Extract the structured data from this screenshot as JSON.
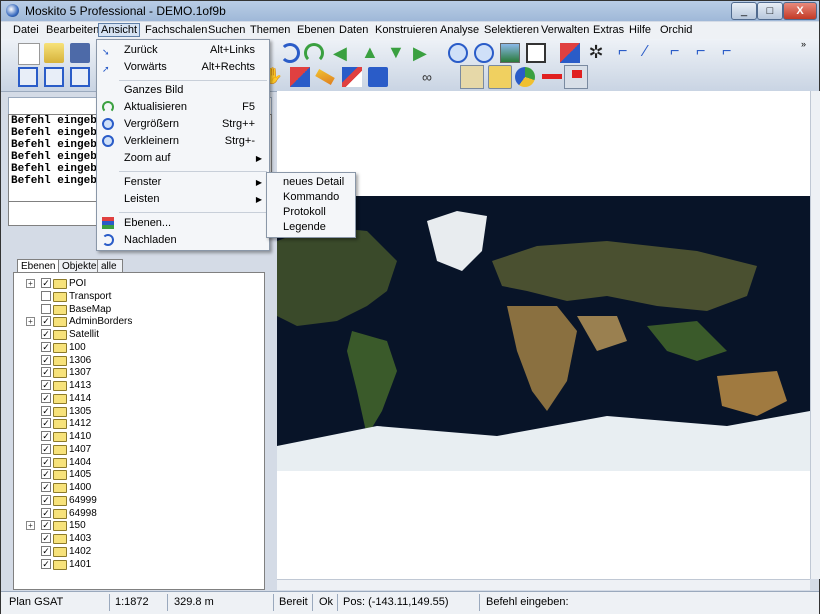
{
  "window": {
    "title": "Moskito 5 Professional - DEMO.1of9b",
    "minimize": "_",
    "maximize": "□",
    "close": "X"
  },
  "menubar": [
    "Datei",
    "Bearbeiten",
    "Ansicht",
    "Fachschalen",
    "Suchen",
    "Themen",
    "Ebenen",
    "Daten",
    "Konstruieren",
    "Analyse",
    "Selektieren",
    "Verwalten",
    "Extras",
    "Hilfe",
    "Orchid"
  ],
  "ansicht_menu": {
    "items": [
      {
        "label": "Zurück",
        "shortcut": "Alt+Links",
        "icon": "back-icon"
      },
      {
        "label": "Vorwärts",
        "shortcut": "Alt+Rechts",
        "icon": "forward-icon"
      },
      {
        "label": "Ganzes Bild",
        "shortcut": ""
      },
      {
        "label": "Aktualisieren",
        "shortcut": "F5",
        "icon": "refresh-icon"
      },
      {
        "label": "Vergrößern",
        "shortcut": "Strg++",
        "icon": "zoom-in-icon"
      },
      {
        "label": "Verkleinern",
        "shortcut": "Strg+-",
        "icon": "zoom-out-icon"
      },
      {
        "label": "Zoom auf",
        "shortcut": "",
        "submenu": true
      },
      {
        "label": "Fenster",
        "submenu": true
      },
      {
        "label": "Leisten",
        "submenu": true
      },
      {
        "label": "Ebenen...",
        "icon": "layers-icon"
      },
      {
        "label": "Nachladen",
        "icon": "reload-icon"
      }
    ]
  },
  "fenster_submenu": [
    "neues Detail",
    "Kommando",
    "Protokoll",
    "Legende"
  ],
  "command_log": [
    "Befehl eingeb",
    "Befehl eingeb",
    "Befehl eingeb",
    "Befehl eingeb",
    "Befehl eingeb",
    "Befehl eingeb"
  ],
  "tree_tabs": [
    "Ebenen",
    "Objekte",
    "alle Obj."
  ],
  "layers": [
    {
      "name": "POI",
      "expand": true,
      "checked": true
    },
    {
      "name": "Transport",
      "expand": false,
      "checked": false
    },
    {
      "name": "BaseMap",
      "expand": false,
      "checked": false
    },
    {
      "name": "AdminBorders",
      "expand": true,
      "checked": true
    },
    {
      "name": "Satellit",
      "expand": false,
      "checked": true
    },
    {
      "name": "100",
      "expand": false,
      "checked": true
    },
    {
      "name": "1306",
      "expand": false,
      "checked": true
    },
    {
      "name": "1307",
      "expand": false,
      "checked": true
    },
    {
      "name": "1413",
      "expand": false,
      "checked": true
    },
    {
      "name": "1414",
      "expand": false,
      "checked": true
    },
    {
      "name": "1305",
      "expand": false,
      "checked": true
    },
    {
      "name": "1412",
      "expand": false,
      "checked": true
    },
    {
      "name": "1410",
      "expand": false,
      "checked": true
    },
    {
      "name": "1407",
      "expand": false,
      "checked": true
    },
    {
      "name": "1404",
      "expand": false,
      "checked": true
    },
    {
      "name": "1405",
      "expand": false,
      "checked": true
    },
    {
      "name": "1400",
      "expand": false,
      "checked": true
    },
    {
      "name": "64999",
      "expand": false,
      "checked": true
    },
    {
      "name": "64998",
      "expand": false,
      "checked": true
    },
    {
      "name": "150",
      "expand": true,
      "checked": true
    },
    {
      "name": "1403",
      "expand": false,
      "checked": true
    },
    {
      "name": "1402",
      "expand": false,
      "checked": true
    },
    {
      "name": "1401",
      "expand": false,
      "checked": true
    }
  ],
  "status": {
    "plan": "Plan GSAT",
    "scale": "1:1872",
    "distance": "329.8 m",
    "ready": "Bereit",
    "ok": "Ok",
    "pos": "Pos: (-143.11,149.55)",
    "prompt": "Befehl eingeben:"
  }
}
